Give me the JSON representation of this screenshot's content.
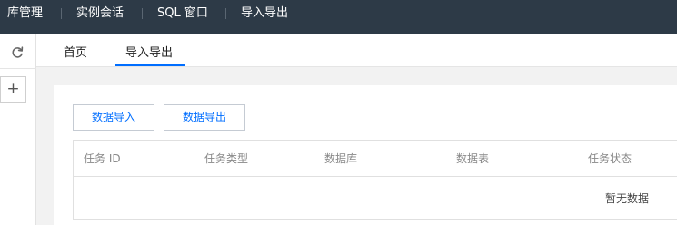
{
  "topnav": {
    "items": [
      {
        "label": "库管理"
      },
      {
        "label": "实例会话"
      },
      {
        "label": "SQL 窗口"
      },
      {
        "label": "导入导出"
      }
    ]
  },
  "sidebar": {
    "refresh_icon": "refresh-icon",
    "add_label": "+"
  },
  "tabs": [
    {
      "label": "首页",
      "active": false
    },
    {
      "label": "导入导出",
      "active": true
    }
  ],
  "actions": {
    "import_label": "数据导入",
    "export_label": "数据导出"
  },
  "table": {
    "columns": [
      "任务 ID",
      "任务类型",
      "数据库",
      "数据表",
      "任务状态"
    ],
    "empty_text": "暂无数据"
  },
  "colors": {
    "topbar": "#2d3a47",
    "accent": "#006eff"
  }
}
